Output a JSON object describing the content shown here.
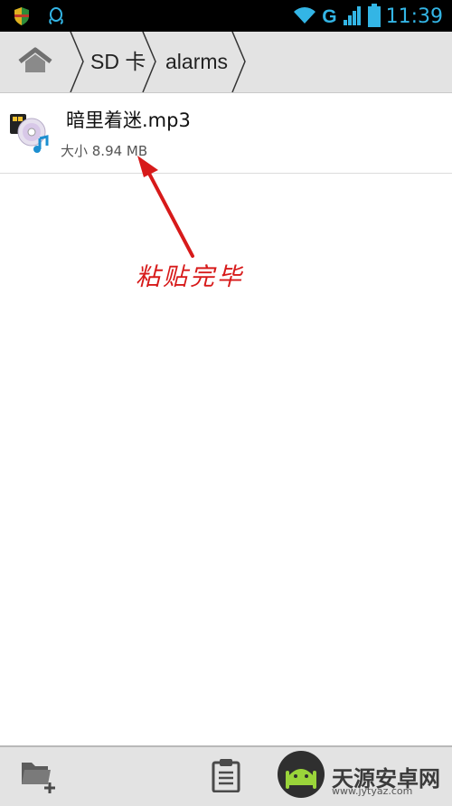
{
  "status_bar": {
    "time": "11:39",
    "network_type": "G",
    "icons": [
      "shield-icon",
      "qq-icon",
      "wifi-icon",
      "signal-icon",
      "battery-icon"
    ],
    "accent_color": "#33b5e5"
  },
  "breadcrumb": {
    "home_icon": "home-icon",
    "items": [
      {
        "label": "SD 卡"
      },
      {
        "label": "alarms"
      }
    ]
  },
  "files": [
    {
      "name": "暗里着迷.mp3",
      "size": "大小 8.94 MB",
      "icon": "audio-file-icon"
    }
  ],
  "annotation": {
    "text": "粘贴完毕",
    "color": "#d71a1a"
  },
  "toolbar": {
    "buttons": [
      "new-folder-icon",
      "paste-icon"
    ]
  },
  "watermark": {
    "text": "天源安卓网",
    "url": "www.jytyaz.com"
  }
}
